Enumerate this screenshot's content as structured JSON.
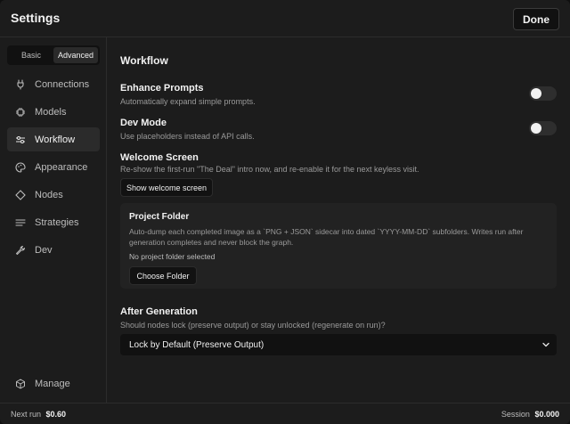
{
  "header": {
    "title": "Settings",
    "done_label": "Done"
  },
  "sidebar": {
    "modes": [
      {
        "label": "Basic",
        "active": false
      },
      {
        "label": "Advanced",
        "active": true
      }
    ],
    "items": [
      {
        "label": "Connections",
        "icon": "plug-icon"
      },
      {
        "label": "Models",
        "icon": "cpu-icon"
      },
      {
        "label": "Workflow",
        "icon": "sliders-icon",
        "active": true
      },
      {
        "label": "Appearance",
        "icon": "palette-icon"
      },
      {
        "label": "Nodes",
        "icon": "diamond-icon"
      },
      {
        "label": "Strategies",
        "icon": "list-icon"
      },
      {
        "label": "Dev",
        "icon": "wrench-icon"
      }
    ],
    "manage_label": "Manage"
  },
  "content": {
    "section_title": "Workflow",
    "enhance": {
      "label": "Enhance Prompts",
      "desc": "Automatically expand simple prompts."
    },
    "devmode": {
      "label": "Dev Mode",
      "desc": "Use placeholders instead of API calls."
    },
    "welcome": {
      "label": "Welcome Screen",
      "desc": "Re-show the first-run \"The Deal\" intro now, and re-enable it for the next keyless visit.",
      "button": "Show welcome screen"
    },
    "project": {
      "title": "Project Folder",
      "desc": "Auto-dump each completed image as a `PNG + JSON` sidecar into dated `YYYY-MM-DD` subfolders. Writes run after generation completes and never block the graph.",
      "status": "No project folder selected",
      "button": "Choose Folder"
    },
    "after": {
      "label": "After Generation",
      "desc": "Should nodes lock (preserve output) or stay unlocked (regenerate on run)?",
      "selected": "Lock by Default (Preserve Output)"
    }
  },
  "footer": {
    "next_label": "Next run",
    "next_value": "$0.60",
    "session_label": "Session",
    "session_value": "$0.000"
  }
}
